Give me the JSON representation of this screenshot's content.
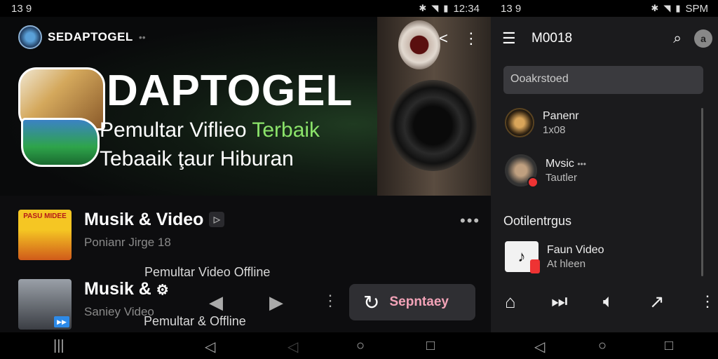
{
  "status_left": {
    "time_left": "13 9",
    "time": "12:34"
  },
  "status_right": {
    "left": "13 9",
    "right": "SPM"
  },
  "hero": {
    "channel_name": "SEDAPTOGEL",
    "channel_dots": "••",
    "title": "DAPTOGEL",
    "subtitle_plain": "Pemultar Viflieo ",
    "subtitle_accent": "Terbaik",
    "subtitle2": "Tebaaik ţaur Hiburan"
  },
  "items": [
    {
      "thumb_text": "PASU MIDEE",
      "title": "Musik & Video",
      "tag": "▷",
      "subtitle": "Ponianr Jirge 18"
    },
    {
      "title": "Musik & ",
      "subtitle": "Saniey Video"
    }
  ],
  "overlay": {
    "line1": "Pemultar Video Offline",
    "line2": "Pemultar & Offline"
  },
  "action_pill": {
    "label": "Sepntaey"
  },
  "right_panel": {
    "title": "M0018",
    "search_field": "Ooakrstoed",
    "avatar_letter": "a",
    "contacts": [
      {
        "name": "Panenr",
        "meta": "1x08"
      },
      {
        "name": "Mvsic",
        "meta": "Tautler",
        "dots": "•••"
      }
    ],
    "section_title": "Ootilentrgus",
    "media_item": {
      "name": "Faun Video",
      "meta": "At hleen"
    }
  }
}
